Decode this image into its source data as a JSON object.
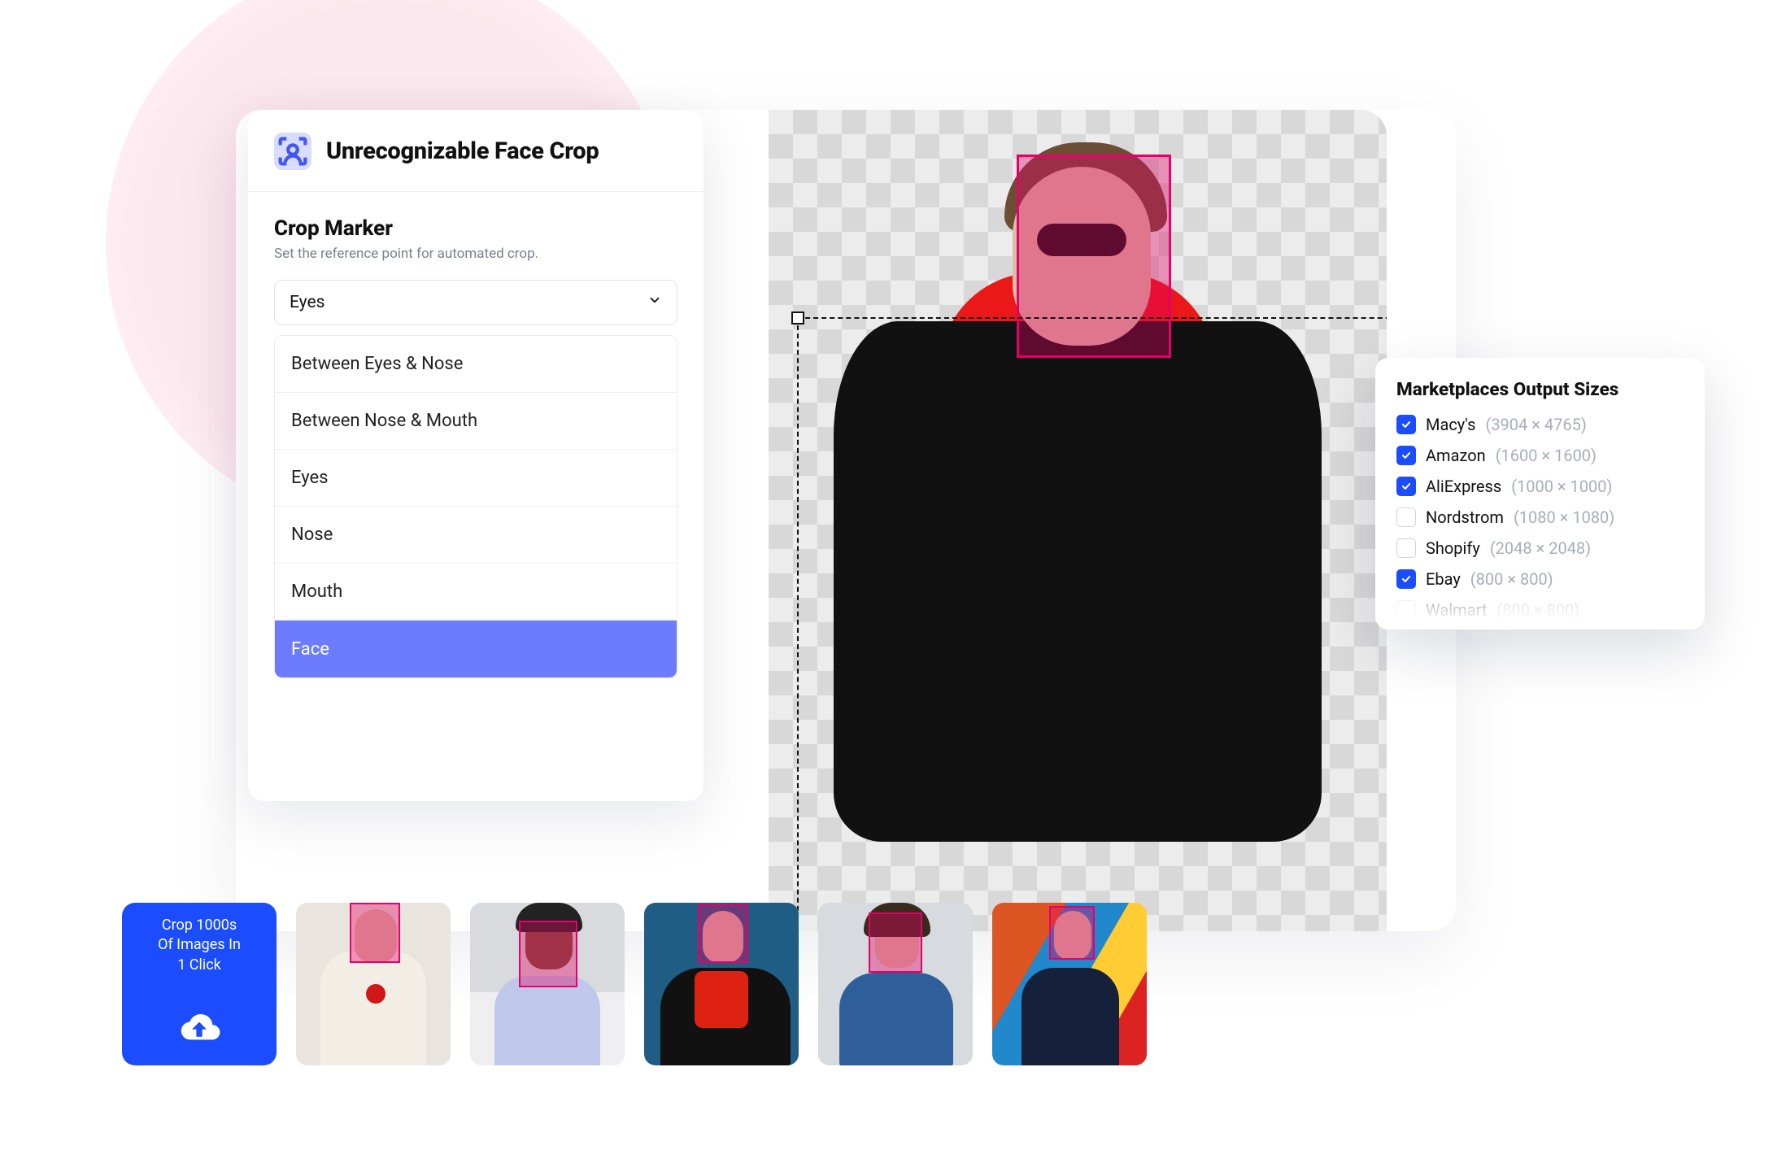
{
  "panel": {
    "title": "Unrecognizable Face Crop",
    "section_title": "Crop Marker",
    "section_desc": "Set the reference point for automated crop.",
    "select_value": "Eyes",
    "options": [
      {
        "label": "Between Eyes & Nose",
        "selected": false
      },
      {
        "label": "Between Nose & Mouth",
        "selected": false
      },
      {
        "label": "Eyes",
        "selected": false
      },
      {
        "label": "Nose",
        "selected": false
      },
      {
        "label": "Mouth",
        "selected": false
      },
      {
        "label": "Face",
        "selected": true
      }
    ]
  },
  "popover": {
    "title": "Marketplaces Output Sizes",
    "items": [
      {
        "name": "Macy's",
        "dims": "(3904 × 4765)",
        "checked": true
      },
      {
        "name": "Amazon",
        "dims": "(1600 × 1600)",
        "checked": true
      },
      {
        "name": "AliExpress",
        "dims": "(1000 × 1000)",
        "checked": true
      },
      {
        "name": "Nordstrom",
        "dims": "(1080 × 1080)",
        "checked": false
      },
      {
        "name": "Shopify",
        "dims": "(2048 × 2048)",
        "checked": false
      },
      {
        "name": "Ebay",
        "dims": "(800 × 800)",
        "checked": true
      },
      {
        "name": "Walmart",
        "dims": "(800 × 800)",
        "checked": false
      }
    ]
  },
  "cta": {
    "line1": "Crop 1000s",
    "line2": "Of Images In",
    "line3": "1 Click"
  }
}
